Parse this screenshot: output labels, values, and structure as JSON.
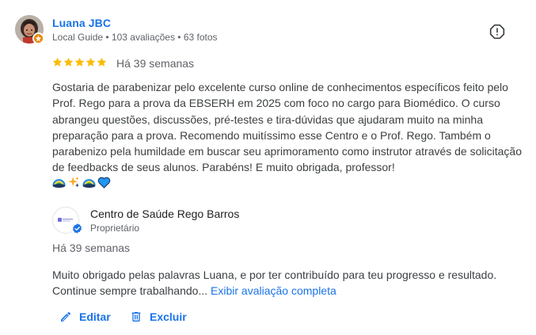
{
  "review": {
    "reviewer_name": "Luana JBC",
    "reviewer_meta": "Local Guide • 103 avaliações • 63 fotos",
    "rating": 5,
    "date": "Há 39 semanas",
    "text": "Gostaria de parabenizar pelo excelente curso online de conhecimentos específicos feito pelo Prof. Rego para a prova da EBSERH em 2025 com foco no cargo para Biomédico. O curso abrangeu questões, discussões, pré-testes e tira-dúvidas que ajudaram muito na minha preparação para a prova. Recomendo muitíssimo esse Centro e o Prof. Rego. Também o parabenizo pela humildade em buscar seu aprimoramento como instrutor através de solicitação de feedbacks de seus alunos. Parabéns! E muito obrigada, professor!",
    "emojis": [
      "rainbow-icon",
      "sparkles-icon",
      "rainbow-icon",
      "blue-heart-icon"
    ]
  },
  "owner_reply": {
    "name": "Centro de Saúde Rego Barros",
    "role": "Proprietário",
    "date": "Há 39 semanas",
    "text": "Muito obrigado pelas palavras Luana, e por ter contribuído para teu progresso e resultado. Continue sempre trabalhando...",
    "expand_label": "Exibir avaliação completa"
  },
  "actions": {
    "edit_label": "Editar",
    "delete_label": "Excluir"
  },
  "colors": {
    "link": "#1a73e8",
    "star": "#fbbc04",
    "secondary_text": "#5f6368",
    "body_text": "#3c4043",
    "badge_orange": "#ea8600"
  },
  "icons": {
    "report": "report-icon",
    "edit": "pencil-icon",
    "delete": "trash-icon",
    "verified": "verified-check-icon",
    "local_guide": "local-guide-star-icon"
  }
}
